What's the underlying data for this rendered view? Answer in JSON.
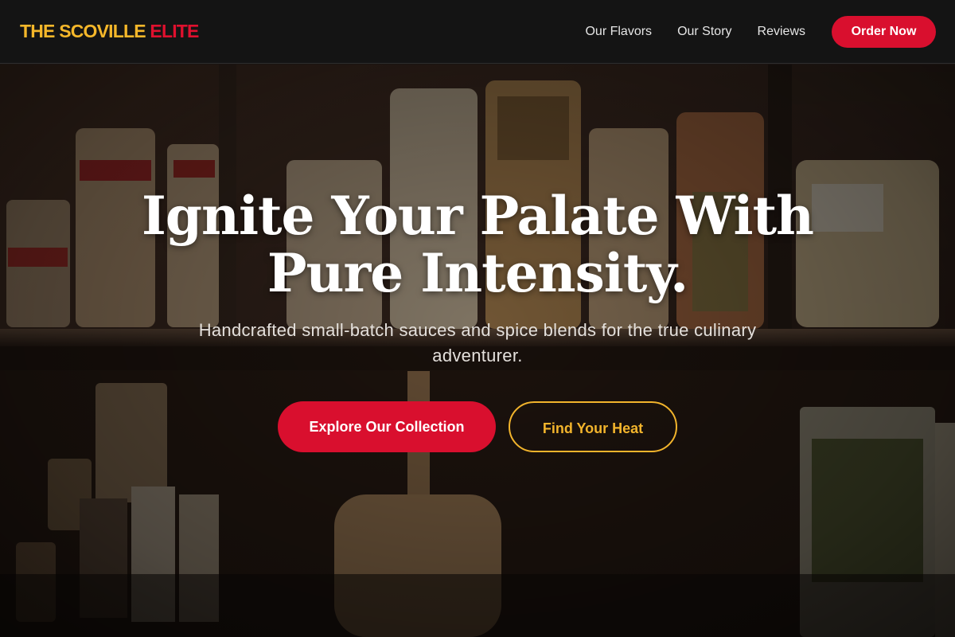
{
  "header": {
    "logo_part1": "THE SCOVILLE",
    "logo_part2": "ELITE",
    "nav": [
      "Our Flavors",
      "Our Story",
      "Reviews"
    ],
    "order_label": "Order Now"
  },
  "hero": {
    "headline_line1": "Ignite Your Palate With",
    "headline_line2": "Pure Intensity.",
    "subhead": "Handcrafted small-batch sauces and spice blends for the true culinary adventurer.",
    "primary_cta": "Explore Our Collection",
    "secondary_cta": "Find Your Heat",
    "background_image": "pantry shelves with bags of pasta"
  },
  "colors": {
    "accent_red": "#d90f2e",
    "accent_gold": "#f2b42c",
    "header_bg": "#141414"
  }
}
